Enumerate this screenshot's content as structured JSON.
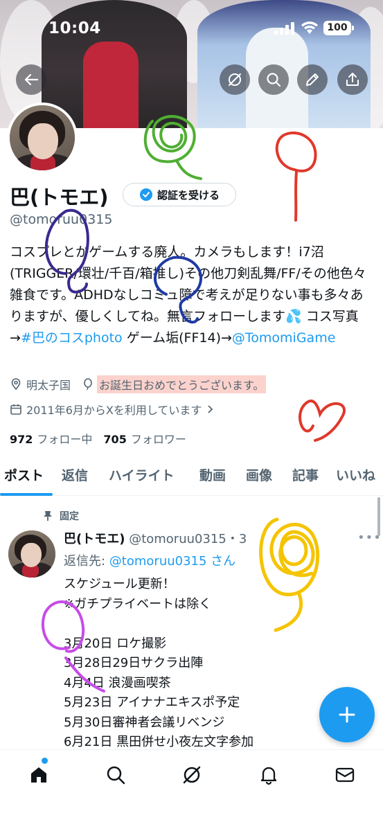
{
  "status_bar": {
    "time": "10:04",
    "battery": "100"
  },
  "header_icons": [
    "back-arrow-icon",
    "grok-icon",
    "search-icon",
    "edit-icon",
    "share-icon"
  ],
  "profile": {
    "name": "巴(トモエ)",
    "verify_button": "認証を受ける",
    "handle": "@tomoruu0315",
    "bio_text": "コスプレとかゲームする廃人。カメラもします！i7沼(TRIGGER/環壮/千百/箱推し)その他刀剣乱舞/FF/その他色々雑食です。ADHDなしコミュ障で考えが足りない事も多々ありますが、優しくしてね。無言フォローします💦 コス写真→",
    "bio_hashtag": "#巴のコスphoto",
    "bio_text2": " ゲーム垢(FF14)→",
    "bio_mention": "@TomomiGame",
    "location": "明太子国",
    "birthday": "お誕生日おめでとうございます。",
    "joined": "2011年6月からXを利用しています",
    "following_count": "972",
    "following_label": "フォロー中",
    "followers_count": "705",
    "followers_label": "フォロワー"
  },
  "tabs": [
    "ポスト",
    "返信",
    "ハイライト",
    "動画",
    "画像",
    "記事",
    "いいね"
  ],
  "post": {
    "pinned_label": "固定",
    "author_name": "巴(トモエ)",
    "author_handle": "@tomoruu0315・3",
    "reply_prefix": "返信先: ",
    "reply_to": "@tomoruu0315 さん",
    "text": "スケジュール更新！\n※ガチプライベートは除く\n\n3月20日 ロケ撮影\n3月28日29日サクラ出陣\n4月4日 浪漫画喫茶\n5月23日 アイナナエキスポ予定\n5月30日審神者会議リベンジ\n6月21日 黒田併せ小夜左文字参加"
  },
  "bottom_nav": [
    "home-icon",
    "search-icon",
    "grok-icon",
    "notifications-icon",
    "messages-icon"
  ],
  "colors": {
    "accent": "#1d9bf0",
    "birthday_highlight": "#fbd2cc"
  }
}
